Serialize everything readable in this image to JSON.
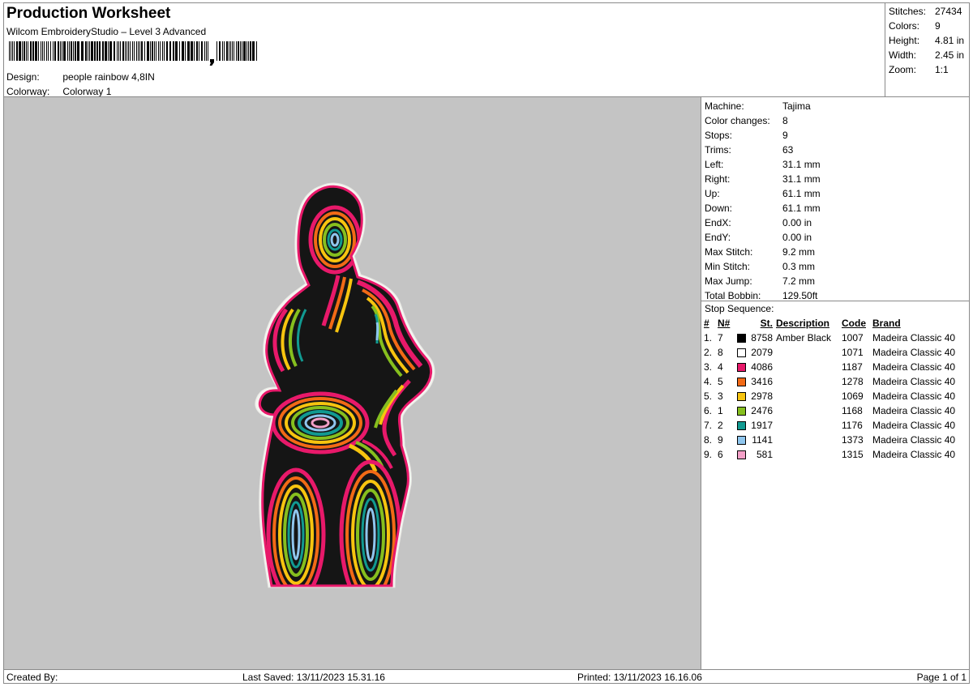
{
  "header": {
    "title": "Production Worksheet",
    "subtitle": "Wilcom EmbroideryStudio – Level 3 Advanced",
    "design_label": "Design:",
    "design_value": "people rainbow 4,8IN",
    "colorway_label": "Colorway:",
    "colorway_value": "Colorway 1"
  },
  "stats": [
    {
      "label": "Stitches:",
      "value": "27434"
    },
    {
      "label": "Colors:",
      "value": "9"
    },
    {
      "label": "Height:",
      "value": "4.81 in"
    },
    {
      "label": "Width:",
      "value": "2.45 in"
    },
    {
      "label": "Zoom:",
      "value": "1:1"
    }
  ],
  "machine_info": [
    {
      "label": "Machine:",
      "value": "Tajima"
    },
    {
      "label": "Color changes:",
      "value": "8"
    },
    {
      "label": "Stops:",
      "value": "9"
    },
    {
      "label": "Trims:",
      "value": "63"
    },
    {
      "label": "Left:",
      "value": "31.1 mm"
    },
    {
      "label": "Right:",
      "value": "31.1 mm"
    },
    {
      "label": "Up:",
      "value": "61.1 mm"
    },
    {
      "label": "Down:",
      "value": "61.1 mm"
    },
    {
      "label": "EndX:",
      "value": "0.00 in"
    },
    {
      "label": "EndY:",
      "value": "0.00 in"
    },
    {
      "label": "Max Stitch:",
      "value": "9.2 mm"
    },
    {
      "label": "Min Stitch:",
      "value": "0.3 mm"
    },
    {
      "label": "Max Jump:",
      "value": "7.2 mm"
    },
    {
      "label": "Total Bobbin:",
      "value": "129.50ft"
    }
  ],
  "stop_sequence": {
    "title": "Stop Sequence:",
    "columns": [
      "#",
      "N#",
      "St.",
      "Description",
      "Code",
      "Brand"
    ],
    "rows": [
      {
        "idx": "1.",
        "n": "7",
        "color": "#000000",
        "st": "8758",
        "desc": "Amber Black",
        "code": "1007",
        "brand": "Madeira Classic 40"
      },
      {
        "idx": "2.",
        "n": "8",
        "color": "#ffffff",
        "st": "2079",
        "desc": "",
        "code": "1071",
        "brand": "Madeira Classic 40"
      },
      {
        "idx": "3.",
        "n": "4",
        "color": "#e8196a",
        "st": "4086",
        "desc": "",
        "code": "1187",
        "brand": "Madeira Classic 40"
      },
      {
        "idx": "4.",
        "n": "5",
        "color": "#f26a16",
        "st": "3416",
        "desc": "",
        "code": "1278",
        "brand": "Madeira Classic 40"
      },
      {
        "idx": "5.",
        "n": "3",
        "color": "#f7c40f",
        "st": "2978",
        "desc": "",
        "code": "1069",
        "brand": "Madeira Classic 40"
      },
      {
        "idx": "6.",
        "n": "1",
        "color": "#86bf1e",
        "st": "2476",
        "desc": "",
        "code": "1168",
        "brand": "Madeira Classic 40"
      },
      {
        "idx": "7.",
        "n": "2",
        "color": "#119a91",
        "st": "1917",
        "desc": "",
        "code": "1176",
        "brand": "Madeira Classic 40"
      },
      {
        "idx": "8.",
        "n": "9",
        "color": "#8fc6ee",
        "st": "1141",
        "desc": "",
        "code": "1373",
        "brand": "Madeira Classic 40"
      },
      {
        "idx": "9.",
        "n": "6",
        "color": "#f4a0c8",
        "st": "581",
        "desc": "",
        "code": "1315",
        "brand": "Madeira Classic 40"
      }
    ]
  },
  "footer": {
    "created_by": "Created By:",
    "last_saved": "Last Saved: 13/11/2023 15.31.16",
    "printed": "Printed: 13/11/2023 16.16.06",
    "page": "Page 1 of 1"
  },
  "colors": {
    "preview_background": "#c4c4c4",
    "border": "#8a8a8a"
  },
  "icons": {
    "barcode": "barcode-graphic",
    "design_preview": "embroidery-design-preview"
  }
}
